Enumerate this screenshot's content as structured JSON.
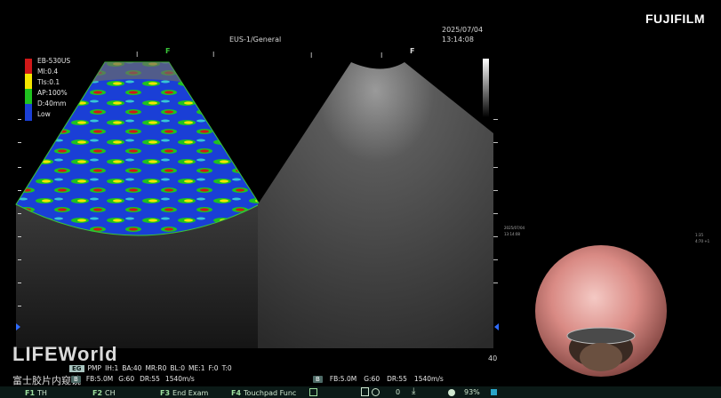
{
  "brand": "FUJIFILM",
  "header": {
    "preset": "EUS-1/General",
    "date": "2025/07/04",
    "time": "13:14:08"
  },
  "left_panel": {
    "probe": "EB-530US",
    "mi": "MI:0.4",
    "tis": "TIs:0.1",
    "ap": "AP:100%",
    "depth": "D:40mm",
    "color_scale_low": "Low",
    "focus_marker": "F",
    "elastography_colors": [
      "#d01818",
      "#f6e600",
      "#1fc21f",
      "#1a3fd6"
    ]
  },
  "right_panel": {
    "focus_marker": "F",
    "depth_value": "40"
  },
  "watermark": {
    "title": "LIFEWorld",
    "subtitle": "富士胶片内窥镜"
  },
  "status_left": {
    "mode": "EG",
    "params": [
      "PMP",
      "IH:1",
      "BA:40",
      "MR:R0",
      "BL:0",
      "ME:1",
      "F:0",
      "T:0"
    ]
  },
  "status_left2": {
    "badge": "B",
    "params": [
      "FB:5.0M",
      "G:60",
      "DR:55",
      "1540m/s"
    ]
  },
  "status_right": {
    "badge": "B",
    "params": [
      "FB:5.0M",
      "G:60",
      "DR:55",
      "1540m/s"
    ]
  },
  "function_keys": [
    {
      "key": "F1",
      "label": "TH"
    },
    {
      "key": "F2",
      "label": "CH"
    },
    {
      "key": "F3",
      "label": "End Exam"
    },
    {
      "key": "F4",
      "label": "Touchpad Func"
    }
  ],
  "counter": "0",
  "zoom_percent": "93%",
  "endoscope_overlay": {
    "small_labels": [
      "2025/07/04",
      "13:14:08"
    ],
    "right_labels": [
      "1:35",
      "4:70 +1"
    ]
  }
}
